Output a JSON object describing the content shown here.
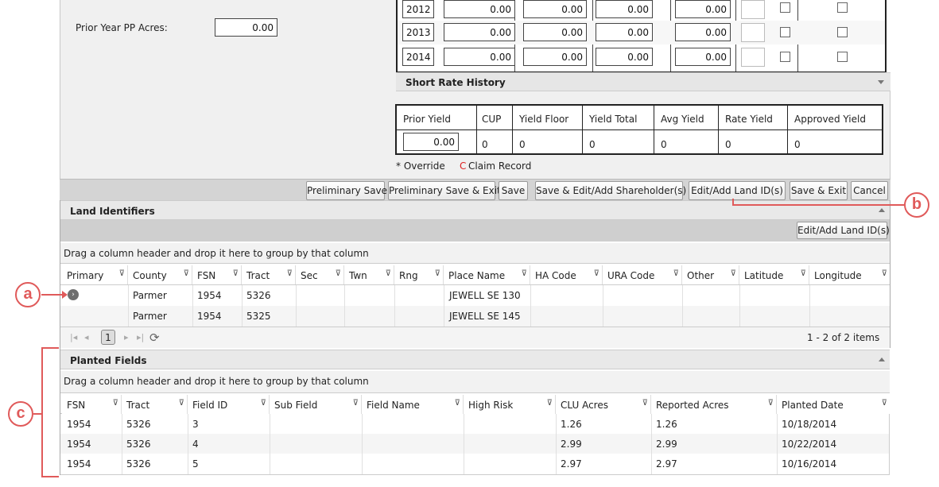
{
  "prior_year": {
    "label": "Prior Year PP Acres:",
    "value": "0.00"
  },
  "history_rows": [
    {
      "year": "2012",
      "v1": "0.00",
      "v2": "0.00",
      "v3": "0.00",
      "v4": "0.00"
    },
    {
      "year": "2013",
      "v1": "0.00",
      "v2": "0.00",
      "v3": "0.00",
      "v4": "0.00"
    },
    {
      "year": "2014",
      "v1": "0.00",
      "v2": "0.00",
      "v3": "0.00",
      "v4": "0.00"
    }
  ],
  "short_rate_history": {
    "title": "Short Rate History"
  },
  "yield_table": {
    "headers": [
      "Prior Yield",
      "CUP",
      "Yield Floor",
      "Yield Total",
      "Avg Yield",
      "Rate Yield",
      "Approved Yield"
    ],
    "prior_yield_value": "0.00",
    "values": [
      "0",
      "0",
      "0",
      "0",
      "0"
    ]
  },
  "legend": {
    "override": "* Override",
    "claim_marker": "C",
    "claim_label": "Claim Record"
  },
  "buttons": {
    "preliminary_save": "Preliminary Save",
    "preliminary_save_exit": "Preliminary Save & Exit",
    "save": "Save",
    "save_edit_shareholders": "Save & Edit/Add Shareholder(s)",
    "edit_land_ids": "Edit/Add Land ID(s)",
    "save_exit": "Save & Exit",
    "cancel": "Cancel"
  },
  "land_identifiers": {
    "title": "Land Identifiers",
    "toolbar_button": "Edit/Add Land ID(s)",
    "drag_hint": "Drag a column header and drop it here to group by that column",
    "columns": [
      "Primary",
      "County",
      "FSN",
      "Tract",
      "Sec",
      "Twn",
      "Rng",
      "Place Name",
      "HA Code",
      "URA Code",
      "Other",
      "Latitude",
      "Longitude"
    ],
    "rows": [
      {
        "county": "Parmer",
        "fsn": "1954",
        "tract": "5326",
        "place": "JEWELL SE 130"
      },
      {
        "county": "Parmer",
        "fsn": "1954",
        "tract": "5325",
        "place": "JEWELL SE 145"
      }
    ],
    "pager": {
      "page": "1",
      "summary": "1 - 2 of 2 items"
    }
  },
  "planted_fields": {
    "title": "Planted Fields",
    "drag_hint": "Drag a column header and drop it here to group by that column",
    "columns": [
      "FSN",
      "Tract",
      "Field ID",
      "Sub Field",
      "Field Name",
      "High Risk",
      "CLU Acres",
      "Reported Acres",
      "Planted Date"
    ],
    "rows": [
      {
        "fsn": "1954",
        "tract": "5326",
        "field_id": "3",
        "clu": "1.26",
        "reported": "1.26",
        "date": "10/18/2014"
      },
      {
        "fsn": "1954",
        "tract": "5326",
        "field_id": "4",
        "clu": "2.99",
        "reported": "2.99",
        "date": "10/22/2014"
      },
      {
        "fsn": "1954",
        "tract": "5326",
        "field_id": "5",
        "clu": "2.97",
        "reported": "2.97",
        "date": "10/16/2014"
      }
    ]
  },
  "callouts": {
    "a": "a",
    "b": "b",
    "c": "c"
  },
  "colors": {
    "callout": "#e05a5a",
    "claim": "#dd2222"
  }
}
